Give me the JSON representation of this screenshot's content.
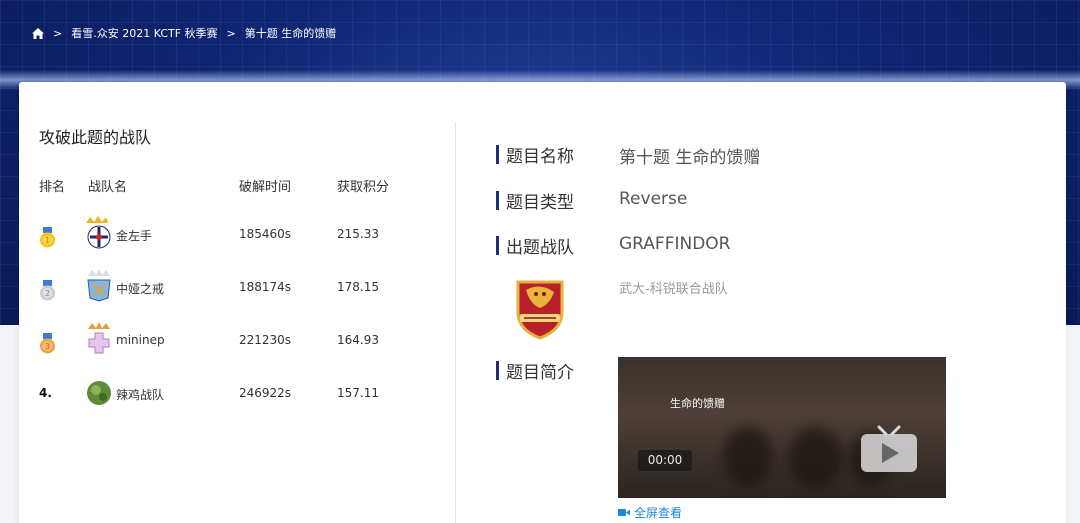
{
  "breadcrumb": {
    "items": [
      "看雪.众安 2021 KCTF 秋季赛",
      "第十题 生命的馈赠"
    ],
    "separator": ">"
  },
  "left": {
    "title": "攻破此题的战队",
    "headers": {
      "rank": "排名",
      "team": "战队名",
      "time": "破解时间",
      "score": "获取积分"
    },
    "rows": [
      {
        "rank": "1",
        "medal": "gold",
        "team": "金左手",
        "time": "185460s",
        "score": "215.33"
      },
      {
        "rank": "2",
        "medal": "silver",
        "team": "中娅之戒",
        "time": "188174s",
        "score": "178.15"
      },
      {
        "rank": "3",
        "medal": "bronze",
        "team": "mininep",
        "time": "221230s",
        "score": "164.93"
      },
      {
        "rank": "4.",
        "medal": "",
        "team": "辣鸡战队",
        "time": "246922s",
        "score": "157.11"
      }
    ]
  },
  "info": {
    "name_label": "题目名称",
    "name_value": "第十题 生命的馈赠",
    "type_label": "题目类型",
    "type_value": "Reverse",
    "team_label": "出题战队",
    "team_value": "GRAFFINDOR",
    "team_desc": "武大-科锐联合战队",
    "intro_label": "题目简介"
  },
  "video": {
    "title": "生命的馈赠",
    "time": "00:00",
    "fullscreen_label": "全屏查看"
  },
  "colors": {
    "accent_bar": "#1f2f7a",
    "link": "#1a86d9",
    "banner": "#0f2470"
  }
}
